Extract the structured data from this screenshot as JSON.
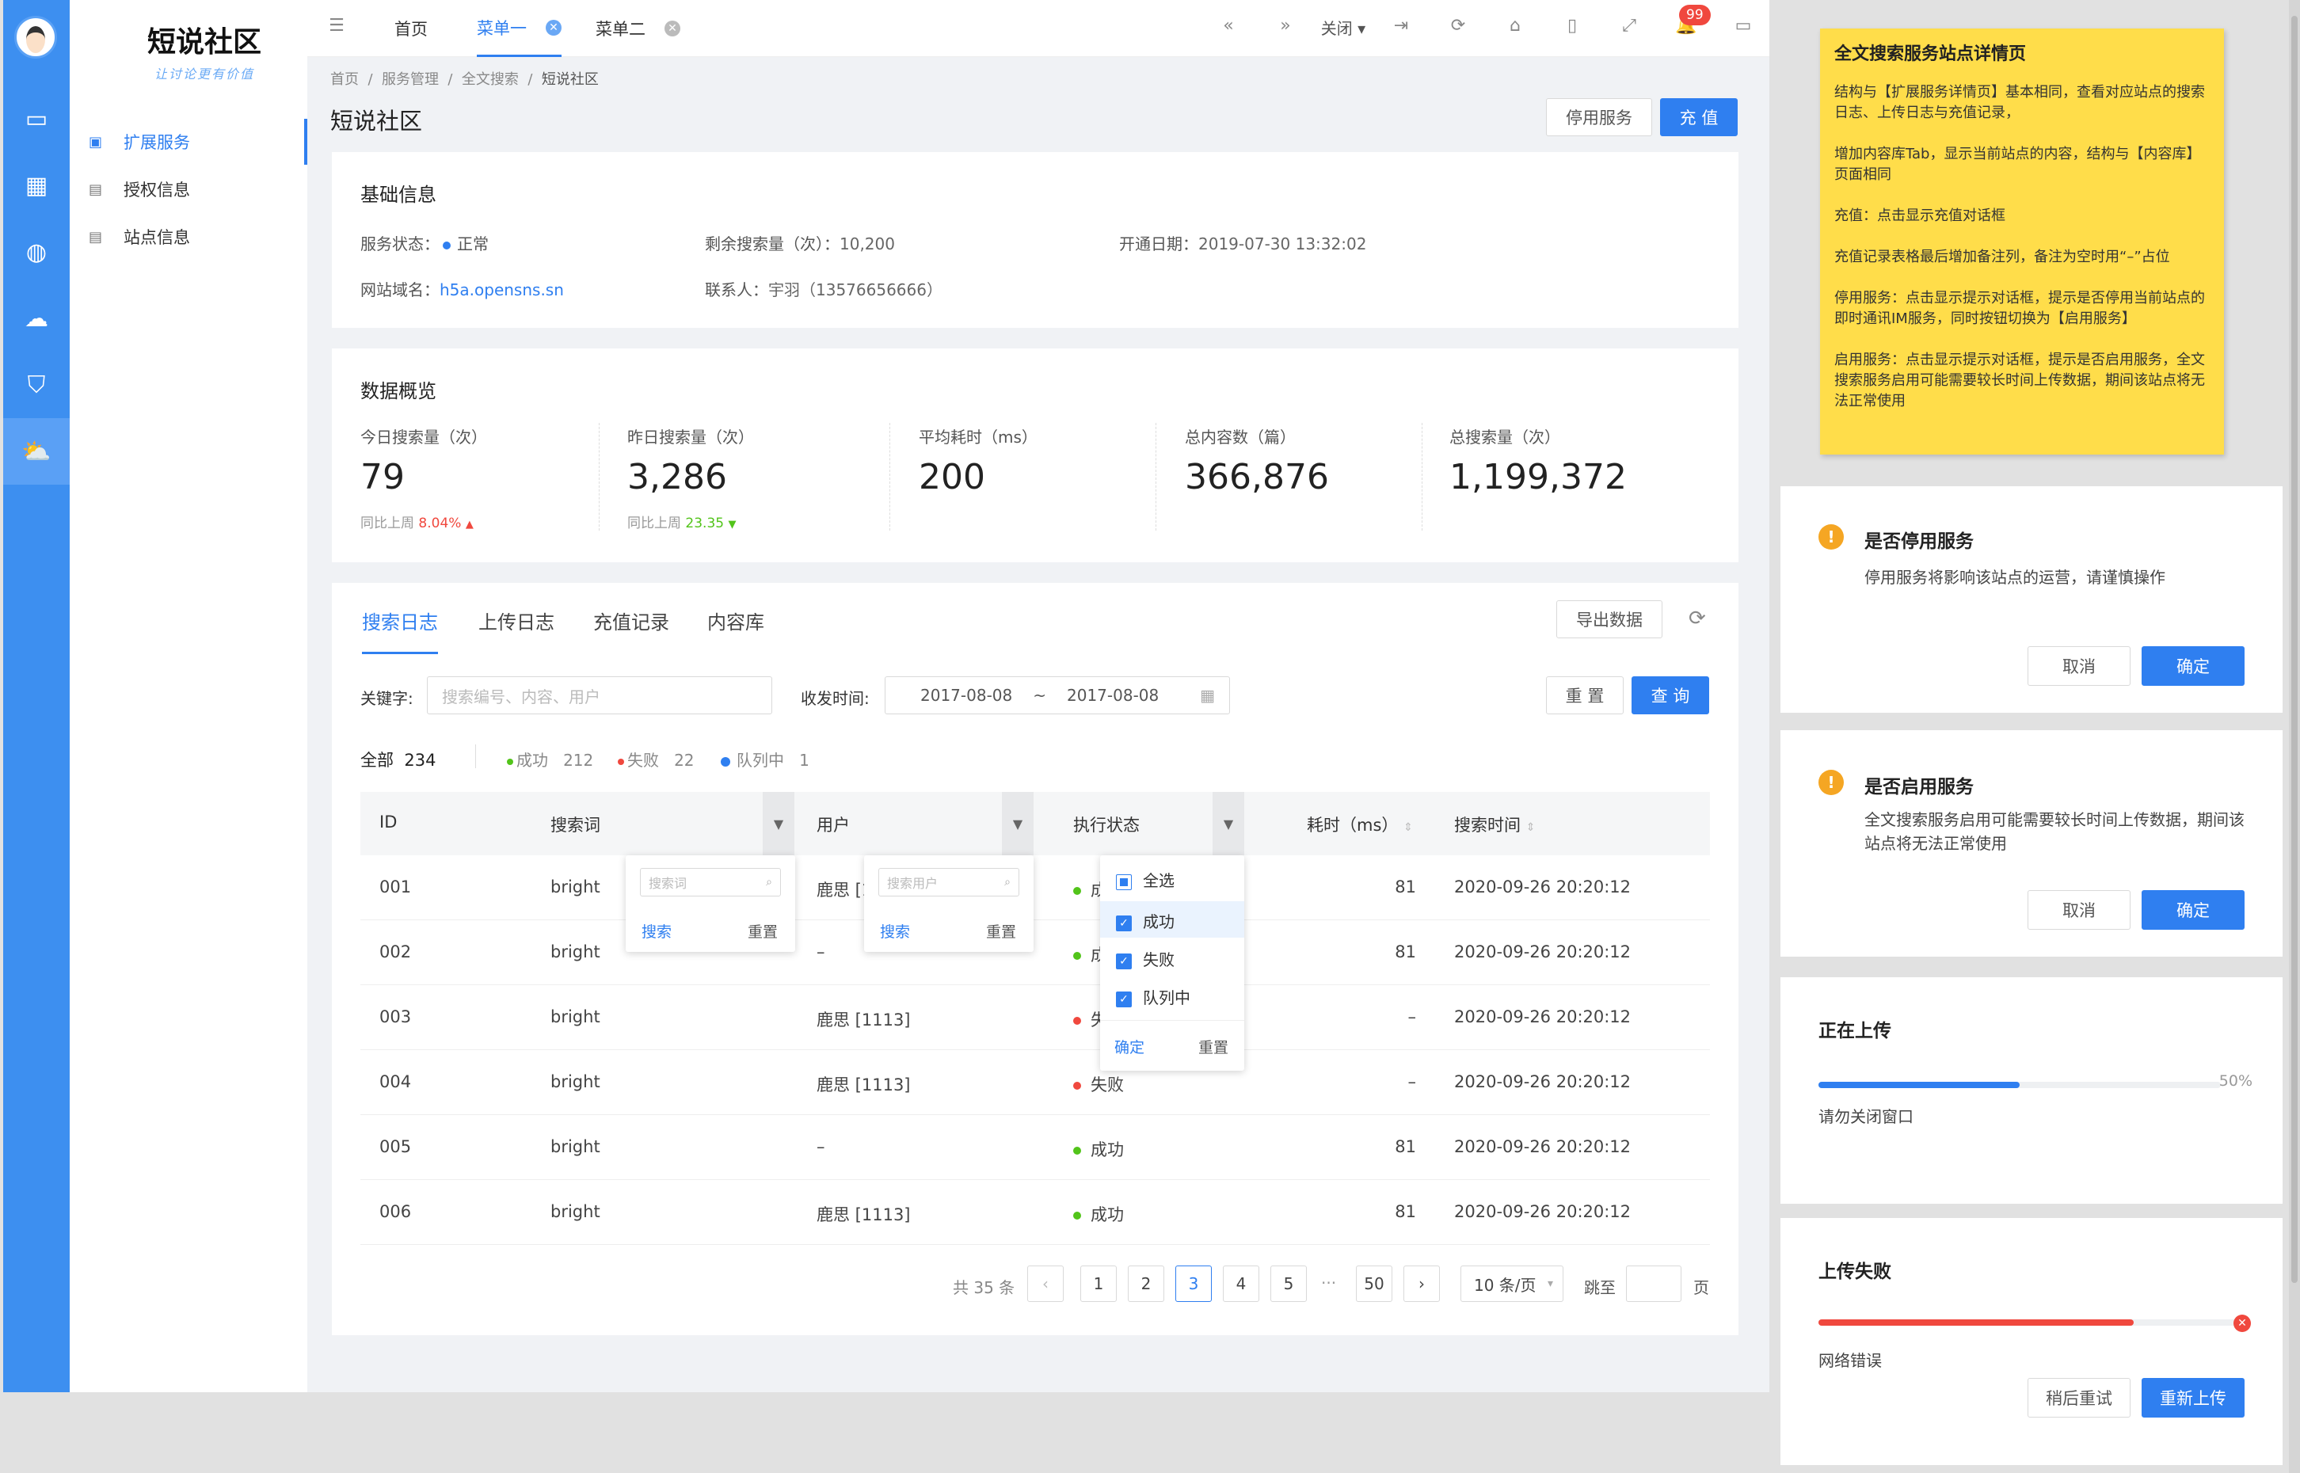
{
  "colors": {
    "primary": "#2f7ff0",
    "success": "#52c41a",
    "error": "#f0483e",
    "warning": "#f5a623",
    "note": "#ffdd4a"
  },
  "sidebar": {
    "icons": [
      "monitor-icon",
      "grid-icon",
      "globe-icon",
      "cloud-icon",
      "shield-icon",
      "cloud-service-icon"
    ],
    "active_icon": "cloud-service-icon"
  },
  "menu": {
    "logo_title": "短说社区",
    "logo_slogan": "让讨论更有价值",
    "items": [
      {
        "label": "扩展服务",
        "icon": "service-icon",
        "active": true
      },
      {
        "label": "授权信息",
        "icon": "doc-icon",
        "active": false
      },
      {
        "label": "站点信息",
        "icon": "doc-icon",
        "active": false
      }
    ]
  },
  "tabs": [
    {
      "label": "首页",
      "active": false,
      "closable": false
    },
    {
      "label": "菜单一",
      "active": true,
      "closable": true
    },
    {
      "label": "菜单二",
      "active": false,
      "closable": true
    }
  ],
  "toolbar": {
    "close_label": "关闭",
    "badge": "99"
  },
  "breadcrumb": [
    "首页",
    "服务管理",
    "全文搜索",
    "短说社区"
  ],
  "page": {
    "title": "短说社区",
    "stop_button": "停用服务",
    "recharge_button": "充 值"
  },
  "basic": {
    "title": "基础信息",
    "status_label": "服务状态：",
    "status_value": "正常",
    "remain_label": "剩余搜索量（次）：",
    "remain_value": "10,200",
    "open_label": "开通日期：",
    "open_value": "2019-07-30 13:32:02",
    "domain_label": "网站域名：",
    "domain_value": "h5a.opensns.sn",
    "contact_label": "联系人：",
    "contact_value": "宇羽（13576656666）"
  },
  "overview": {
    "title": "数据概览",
    "stats": [
      {
        "label": "今日搜索量（次）",
        "value": "79",
        "compare_label": "同比上周",
        "compare_value": "8.04%",
        "trend": "up"
      },
      {
        "label": "昨日搜索量（次）",
        "value": "3,286",
        "compare_label": "同比上周",
        "compare_value": "23.35",
        "trend": "down"
      },
      {
        "label": "平均耗时（ms）",
        "value": "200"
      },
      {
        "label": "总内容数（篇）",
        "value": "366,876"
      },
      {
        "label": "总搜索量（次）",
        "value": "1,199,372"
      }
    ]
  },
  "logs": {
    "tabs": [
      "搜索日志",
      "上传日志",
      "充值记录",
      "内容库"
    ],
    "active_tab": "搜索日志",
    "export_button": "导出数据",
    "filter": {
      "keyword_label": "关键字:",
      "keyword_placeholder": "搜索编号、内容、用户",
      "time_label": "收发时间:",
      "date_from": "2017-08-08",
      "date_sep": "~",
      "date_to": "2017-08-08",
      "reset_button": "重 置",
      "query_button": "查 询"
    },
    "summary": {
      "all_label": "全部",
      "all_count": "234",
      "success_label": "成功",
      "success_count": "212",
      "fail_label": "失败",
      "fail_count": "22",
      "queue_label": "队列中",
      "queue_count": "1"
    },
    "columns": [
      "ID",
      "搜索词",
      "用户",
      "执行状态",
      "耗时（ms）",
      "搜索时间"
    ],
    "rows": [
      {
        "id": "001",
        "term": "bright",
        "user": "鹿思 [1113]",
        "status": "成功",
        "cost": "81",
        "time": "2020-09-26 20:20:12"
      },
      {
        "id": "002",
        "term": "bright",
        "user": "–",
        "status": "成功",
        "cost": "81",
        "time": "2020-09-26 20:20:12"
      },
      {
        "id": "003",
        "term": "bright",
        "user": "鹿思 [1113]",
        "status": "失败",
        "cost": "–",
        "time": "2020-09-26 20:20:12"
      },
      {
        "id": "004",
        "term": "bright",
        "user": "鹿思 [1113]",
        "status": "失败",
        "cost": "–",
        "time": "2020-09-26 20:20:12"
      },
      {
        "id": "005",
        "term": "bright",
        "user": "–",
        "status": "成功",
        "cost": "81",
        "time": "2020-09-26 20:20:12"
      },
      {
        "id": "006",
        "term": "bright",
        "user": "鹿思 [1113]",
        "status": "成功",
        "cost": "81",
        "time": "2020-09-26 20:20:12"
      }
    ],
    "term_popup": {
      "placeholder": "搜索词",
      "search": "搜索",
      "reset": "重置"
    },
    "user_popup": {
      "placeholder": "搜索用户",
      "search": "搜索",
      "reset": "重置"
    },
    "status_popup": {
      "all": "全选",
      "options": [
        "成功",
        "失败",
        "队列中"
      ],
      "confirm": "确定",
      "reset": "重置"
    },
    "pagination": {
      "total": "共 35 条",
      "prev": "‹",
      "pages": [
        "1",
        "2",
        "3",
        "4",
        "5"
      ],
      "current": "3",
      "ellipsis": "···",
      "last": "50",
      "next": "›",
      "page_size": "10 条/页",
      "jump_label": "跳至",
      "page_unit": "页"
    }
  },
  "note": {
    "title": "全文搜索服务站点详情页",
    "paragraphs": [
      "结构与【扩展服务详情页】基本相同，查看对应站点的搜索日志、上传日志与充值记录，",
      "增加内容库Tab，显示当前站点的内容，结构与【内容库】页面相同",
      "充值：点击显示充值对话框",
      "充值记录表格最后增加备注列，备注为空时用“–”占位",
      "停用服务：点击显示提示对话框，提示是否停用当前站点的即时通讯IM服务，同时按钮切换为【启用服务】",
      "启用服务：点击显示提示对话框，提示是否启用服务，全文搜索服务启用可能需要较长时间上传数据，期间该站点将无法正常使用"
    ]
  },
  "dialogs": {
    "stop": {
      "title": "是否停用服务",
      "message": "停用服务将影响该站点的运营，请谨慎操作",
      "cancel": "取消",
      "ok": "确定"
    },
    "start": {
      "title": "是否启用服务",
      "message": "全文搜索服务启用可能需要较长时间上传数据，期间该站点将无法正常使用",
      "cancel": "取消",
      "ok": "确定"
    },
    "uploading": {
      "title": "正在上传",
      "percent_label": "50%",
      "progress": 0.5,
      "hint": "请勿关闭窗口"
    },
    "failed": {
      "title": "上传失败",
      "progress": 0.75,
      "error": "网络错误",
      "later": "稍后重试",
      "retry": "重新上传"
    }
  }
}
